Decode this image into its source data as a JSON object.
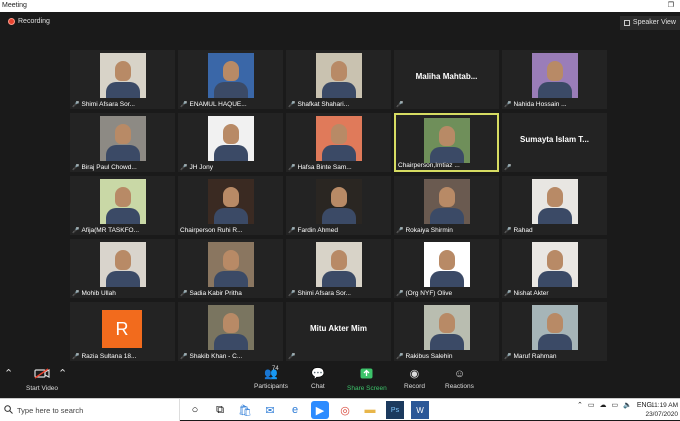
{
  "window": {
    "title": "Meeting",
    "restore_glyph": "❐"
  },
  "topbar": {
    "recording_label": "Recording",
    "speaker_view_label": "Speaker View"
  },
  "tiles": [
    {
      "name": "Shimi Afsara Sor...",
      "muted": true,
      "type": "video",
      "bg": "#d8d3c8"
    },
    {
      "name": "ENAMUL HAQUE...",
      "muted": true,
      "type": "video",
      "bg": "#3a67a8"
    },
    {
      "name": "Shafkat Shahari...",
      "muted": true,
      "type": "video",
      "bg": "#c9c2b0"
    },
    {
      "name": "",
      "display_name": "Maliha Mahtab...",
      "muted": true,
      "type": "name"
    },
    {
      "name": "Nahida Hossain ...",
      "muted": true,
      "type": "video",
      "bg": "#9a7db8"
    },
    {
      "name": "Biraj Paul Chowd...",
      "muted": true,
      "type": "video",
      "bg": "#8d8a84"
    },
    {
      "name": "JH Jony",
      "muted": true,
      "type": "video",
      "bg": "#f1f1f1"
    },
    {
      "name": "Hafsa Binte Sam...",
      "muted": true,
      "type": "video",
      "bg": "#e07a5a"
    },
    {
      "name": "Chairperson,Imtiaz ...",
      "muted": false,
      "type": "video",
      "bg": "#6f8f5a",
      "active": true
    },
    {
      "name": "",
      "display_name": "Sumayta Islam T...",
      "muted": true,
      "type": "name"
    },
    {
      "name": "Afija(MR TASKFO...",
      "muted": true,
      "type": "video",
      "bg": "#c9d8a6"
    },
    {
      "name": "Chairperson Ruhi R...",
      "muted": false,
      "type": "video",
      "bg": "#3a2a22"
    },
    {
      "name": "Fardin Ahmed",
      "muted": true,
      "type": "video",
      "bg": "#2a2622"
    },
    {
      "name": "Rokaiya Shirmin",
      "muted": true,
      "type": "video",
      "bg": "#6a5a50"
    },
    {
      "name": "Rahad",
      "muted": true,
      "type": "video",
      "bg": "#e8e6e2"
    },
    {
      "name": "Mohib Ullah",
      "muted": true,
      "type": "video",
      "bg": "#d9d4cc"
    },
    {
      "name": "Sadia Kabir Pritha",
      "muted": true,
      "type": "video",
      "bg": "#8a7660"
    },
    {
      "name": "Shimi Afsara Sor...",
      "muted": true,
      "type": "video",
      "bg": "#d8d3c8"
    },
    {
      "name": "(Org NYF) Olive",
      "muted": true,
      "type": "video",
      "bg": "#ffffff"
    },
    {
      "name": "Nishat Akter",
      "muted": true,
      "type": "video",
      "bg": "#eae7e3"
    },
    {
      "name": "Razia Sultana 18...",
      "muted": true,
      "type": "avatar",
      "initial": "R",
      "avatar_color": "#f26b1d"
    },
    {
      "name": "Shakib Khan - C...",
      "muted": true,
      "type": "video",
      "bg": "#7a7560"
    },
    {
      "name": "",
      "display_name": "Mitu Akter Mim",
      "muted": true,
      "type": "name"
    },
    {
      "name": "Rakibus Salehin",
      "muted": true,
      "type": "video",
      "bg": "#b9bdb0"
    },
    {
      "name": "Maruf Rahman",
      "muted": true,
      "type": "video",
      "bg": "#a6b5b8"
    }
  ],
  "toolbar": {
    "start_video": "Start Video",
    "participants": "Participants",
    "participants_count": "74",
    "chat": "Chat",
    "share_screen": "Share Screen",
    "record": "Record",
    "reactions": "Reactions"
  },
  "taskbar": {
    "search_placeholder": "Type here to search",
    "lang": "ENG",
    "time": "11:19 AM",
    "date": "23/07/2020"
  },
  "colors": {
    "active_border": "#d6dc62",
    "share_green": "#3cc36a",
    "recording_red": "#e8432f"
  }
}
